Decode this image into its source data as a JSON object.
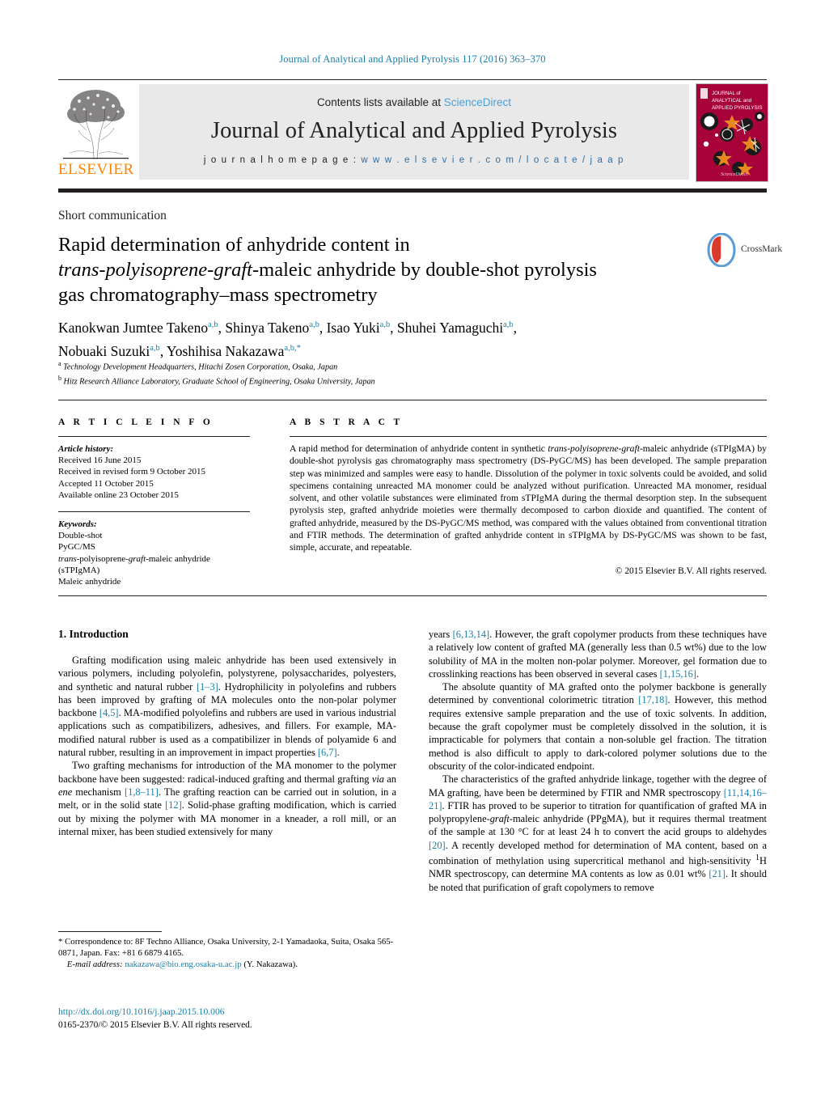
{
  "running_head": "Journal of Analytical and Applied Pyrolysis 117 (2016) 363–370",
  "masthead": {
    "publisher_name": "ELSEVIER",
    "contents_prefix": "Contents lists available at ",
    "contents_link": "ScienceDirect",
    "journal_title": "Journal of Analytical and Applied Pyrolysis",
    "homepage_label": "j o u r n a l   h o m e p a g e :   ",
    "homepage_url": "w w w . e l s e v i e r . c o m / l o c a t e / j a a p",
    "cover_title_line1": "JOURNAL of",
    "cover_title_line2": "ANALYTICAL and",
    "cover_title_line3": "APPLIED PYROLYSIS",
    "cover_color": "#a8023a",
    "accent_orange": "#ff8200",
    "link_blue": "#2e6da4"
  },
  "article": {
    "type": "Short communication",
    "title_line1": "Rapid determination of anhydride content in",
    "title_italic1": "trans-polyisoprene-graft",
    "title_line2": "-maleic anhydride by double-shot pyrolysis",
    "title_line3": "gas chromatography–mass spectrometry",
    "crossmark_label": "CrossMark"
  },
  "authors": {
    "list": "Kanokwan Jumtee Takeno",
    "full_line1_a": "Kanokwan Jumtee Takeno",
    "full_line1_b": ", Shinya Takeno",
    "full_line1_c": ", Isao Yuki",
    "full_line1_d": ", Shuhei Yamaguchi",
    "full_line2_a": "Nobuaki Suzuki",
    "full_line2_b": ", Yoshihisa Nakazawa",
    "aff_marker": "a,b",
    "aff_marker_star": "a,b,*",
    "affiliation_a_marker": "a",
    "affiliation_a": " Technology Development Headquarters, Hitachi Zosen Corporation, Osaka, Japan",
    "affiliation_b_marker": "b",
    "affiliation_b": " Hitz Research Alliance Laboratory, Graduate School of Engineering, Osaka University, Japan"
  },
  "info": {
    "heading_article_info": "A R T I C L E    I N F O",
    "heading_abstract": "A B S T R A C T",
    "history_label": "Article history:",
    "history_items": [
      "Received 16 June 2015",
      "Received in revised form 9 October 2015",
      "Accepted 11 October 2015",
      "Available online 23 October 2015"
    ],
    "keywords_label": "Keywords:",
    "keywords": [
      "Double-shot",
      "PyGC/MS",
      "trans-polyisoprene-graft-maleic anhydride (sTPIgMA)",
      "Maleic anhydride"
    ],
    "keyword_3_pre": "",
    "keyword_3_italic1": "trans",
    "keyword_3_mid": "-polyisoprene-",
    "keyword_3_italic2": "graft",
    "keyword_3_post": "-maleic anhydride",
    "keyword_3_line2": "(sTPIgMA)"
  },
  "abstract": {
    "p1": "A rapid method for determination of anhydride content in synthetic ",
    "p1_italic": "trans-polyisoprene-graft",
    "p2": "-maleic anhydride (sTPIgMA) by double-shot pyrolysis gas chromatography mass spectrometry (DS-PyGC/MS) has been developed. The sample preparation step was minimized and samples were easy to handle. Dissolution of the polymer in toxic solvents could be avoided, and solid specimens containing unreacted MA monomer could be analyzed without purification. Unreacted MA monomer, residual solvent, and other volatile substances were eliminated from sTPIgMA during the thermal desorption step. In the subsequent pyrolysis step, grafted anhydride moieties were thermally decomposed to carbon dioxide and quantified. The content of grafted anhydride, measured by the DS-PyGC/MS method, was compared with the values obtained from conventional titration and FTIR methods. The determination of grafted anhydride content in sTPIgMA by DS-PyGC/MS was shown to be fast, simple, accurate, and repeatable.",
    "copyright": "© 2015 Elsevier B.V. All rights reserved."
  },
  "body": {
    "section_number_title": "1.   Introduction",
    "left_p1_a": "Grafting modification using maleic anhydride has been used extensively in various polymers, including polyolefin, polystyrene, polysaccharides, polyesters, and synthetic and natural rubber ",
    "left_p1_ref1": "[1–3]",
    "left_p1_b": ". Hydrophilicity in polyolefins and rubbers has been improved by grafting of MA molecules onto the non-polar polymer backbone ",
    "left_p1_ref2": "[4,5]",
    "left_p1_c": ". MA-modified polyolefins and rubbers are used in various industrial applications such as compatibilizers, adhesives, and fillers. For example, MA-modified natural rubber is used as a compatibilizer in blends of polyamide 6 and natural rubber, resulting in an improvement in impact properties ",
    "left_p1_ref3": "[6,7]",
    "left_p1_d": ".",
    "left_p2_a": "Two grafting mechanisms for introduction of the MA monomer to the polymer backbone have been suggested: radical-induced grafting and thermal grafting ",
    "left_p2_italic1": "via",
    "left_p2_b": " an ",
    "left_p2_italic2": "ene",
    "left_p2_c": " mechanism ",
    "left_p2_ref1": "[1,8–11]",
    "left_p2_d": ". The grafting reaction can be carried out in solution, in a melt, or in the solid state ",
    "left_p2_ref2": "[12]",
    "left_p2_e": ". Solid-phase grafting modification, which is carried out by mixing the polymer with MA monomer in a kneader, a roll mill, or an internal mixer, has been studied extensively for many",
    "right_p1_a": "years ",
    "right_p1_ref1": "[6,13,14]",
    "right_p1_b": ". However, the graft copolymer products from these techniques have a relatively low content of grafted MA (generally less than 0.5 wt%) due to the low solubility of MA in the molten non-polar polymer. Moreover, gel formation due to crosslinking reactions has been observed in several cases ",
    "right_p1_ref2": "[1,15,16]",
    "right_p1_c": ".",
    "right_p2_a": "The absolute quantity of MA grafted onto the polymer backbone is generally determined by conventional colorimetric titration ",
    "right_p2_ref1": "[17,18]",
    "right_p2_b": ". However, this method requires extensive sample preparation and the use of toxic solvents. In addition, because the graft copolymer must be completely dissolved in the solution, it is impracticable for polymers that contain a non-soluble gel fraction. The titration method is also difficult to apply to dark-colored polymer solutions due to the obscurity of the color-indicated endpoint.",
    "right_p3_a": "The characteristics of the grafted anhydride linkage, together with the degree of MA grafting, have been be determined by FTIR and NMR spectroscopy ",
    "right_p3_ref1": "[11,14,16–21]",
    "right_p3_b": ". FTIR has proved to be superior to titration for quantification of grafted MA in polypropylene-",
    "right_p3_italic1": "graft",
    "right_p3_c": "-maleic anhydride (PPgMA), but it requires thermal treatment of the sample at 130 °C for at least 24 h to convert the acid groups to aldehydes ",
    "right_p3_ref2": "[20]",
    "right_p3_d": ". A recently developed method for determination of MA content, based on a combination of methylation using supercritical methanol and high-sensitivity ",
    "right_p3_sup": "1",
    "right_p3_e": "H NMR spectroscopy, can determine MA contents as low as 0.01 wt% ",
    "right_p3_ref3": "[21]",
    "right_p3_f": ". It should be noted that purification of graft copolymers to remove"
  },
  "footer": {
    "correspondence_marker": "*",
    "correspondence": " Correspondence to: 8F Techno Alliance, Osaka University, 2-1 Yamadaoka, Suita, Osaka 565-0871, Japan. Fax: +81 6 6879 4165.",
    "email_label": "E-mail address:",
    "email": "nakazawa@bio.eng.osaka-u.ac.jp",
    "email_suffix": " (Y. Nakazawa).",
    "doi": "http://dx.doi.org/10.1016/j.jaap.2015.10.006",
    "issn": "0165-2370/© 2015 Elsevier B.V. All rights reserved."
  }
}
